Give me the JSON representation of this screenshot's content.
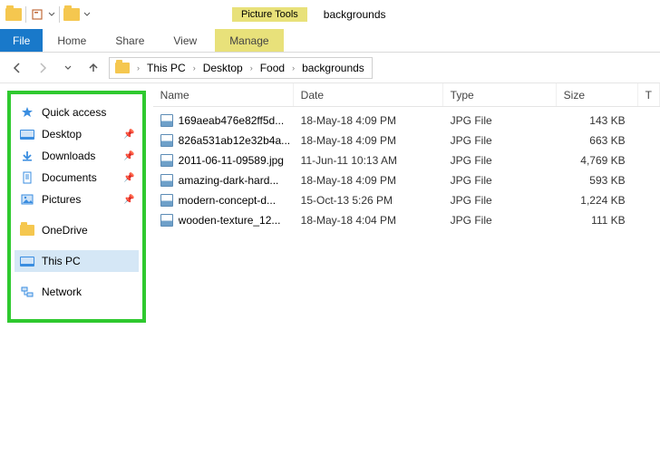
{
  "titlebar": {
    "tools_label": "Picture Tools",
    "window_title": "backgrounds"
  },
  "ribbon": {
    "file": "File",
    "tabs": [
      "Home",
      "Share",
      "View"
    ],
    "tool_tab": "Manage"
  },
  "breadcrumb": {
    "segments": [
      "This PC",
      "Desktop",
      "Food",
      "backgrounds"
    ]
  },
  "sidebar": {
    "quick_access": "Quick access",
    "quick_items": [
      {
        "label": "Desktop",
        "icon": "monitor"
      },
      {
        "label": "Downloads",
        "icon": "download"
      },
      {
        "label": "Documents",
        "icon": "document"
      },
      {
        "label": "Pictures",
        "icon": "pictures"
      }
    ],
    "onedrive": "OneDrive",
    "this_pc": "This PC",
    "network": "Network"
  },
  "columns": {
    "name": "Name",
    "date": "Date",
    "type": "Type",
    "size": "Size",
    "last": "T"
  },
  "files": [
    {
      "name": "169aeab476e82ff5d...",
      "date": "18-May-18 4:09 PM",
      "type": "JPG File",
      "size": "143 KB"
    },
    {
      "name": "826a531ab12e32b4a...",
      "date": "18-May-18 4:09 PM",
      "type": "JPG File",
      "size": "663 KB"
    },
    {
      "name": "2011-06-11-09589.jpg",
      "date": "11-Jun-11 10:13 AM",
      "type": "JPG File",
      "size": "4,769 KB"
    },
    {
      "name": "amazing-dark-hard...",
      "date": "18-May-18 4:09 PM",
      "type": "JPG File",
      "size": "593 KB"
    },
    {
      "name": "modern-concept-d...",
      "date": "15-Oct-13 5:26 PM",
      "type": "JPG File",
      "size": "1,224 KB"
    },
    {
      "name": "wooden-texture_12...",
      "date": "18-May-18 4:04 PM",
      "type": "JPG File",
      "size": "111 KB"
    }
  ]
}
